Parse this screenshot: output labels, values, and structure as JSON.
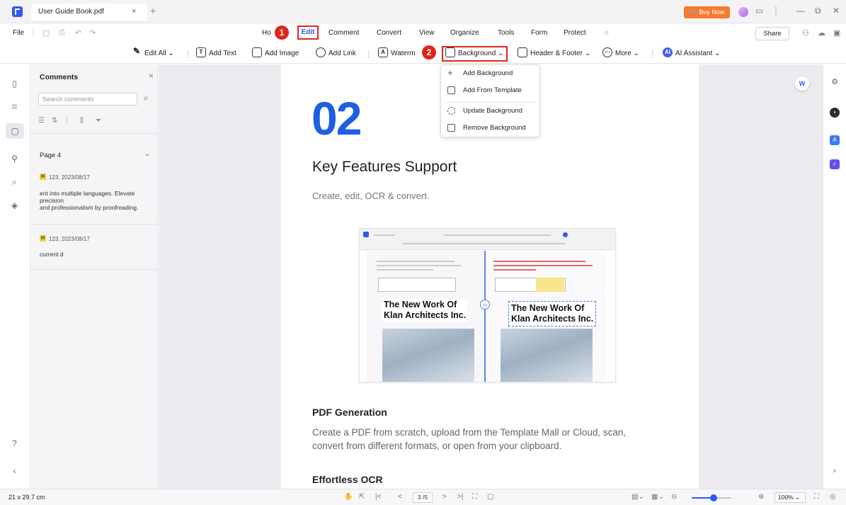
{
  "titlebar": {
    "tab_title": "User Guide Book.pdf",
    "tab_close": "×",
    "new_tab": "+",
    "buy_now": "🛒 Buy Now",
    "buy_now_color": "#f77a2f",
    "window_controls": [
      "—",
      "⧉",
      "✕"
    ],
    "icons": [
      "avatar-icon",
      "chat-icon",
      "more-icon"
    ]
  },
  "menubar": {
    "file": "File",
    "items": [
      "Home",
      "Edit",
      "Comment",
      "Convert",
      "View",
      "Organize",
      "Tools",
      "Form",
      "Protect"
    ],
    "home_visible": "Ho",
    "active": "Edit",
    "share": "Share",
    "accent_color": "#2a5bd7"
  },
  "badges": [
    "1",
    "2"
  ],
  "badge_color": "#e0261c",
  "toolbar": {
    "edit_all": "Edit All",
    "add_text": "Add Text",
    "add_image": "Add Image",
    "add_link": "Add Link",
    "watermark": "Waterm",
    "background": "Background",
    "header_footer": "Header & Footer",
    "more": "More",
    "ai_assistant": "AI Assistant",
    "text_icon": "T",
    "watermark_icon": "A",
    "ai_icon": "AI",
    "dropdown_caret": "⌄"
  },
  "background_menu": [
    "Add Background",
    "Add From Template",
    "Update Background",
    "Remove Background"
  ],
  "comments_panel": {
    "title": "Comments",
    "close": "×",
    "search_placeholder": "Search comments",
    "page_label": "Page 4",
    "comments": [
      {
        "tag": "H",
        "meta": "123, 2023/08/17",
        "text": "ent into multiple languages. Elevate precision\nand professionalism by proofreading."
      },
      {
        "tag": "H",
        "meta": "123, 2023/08/17",
        "text": "current d"
      }
    ]
  },
  "document": {
    "section_number": "02",
    "title": "Key Features Support",
    "subtitle": "Create, edit, OCR & convert.",
    "embedded_heading": "The New Work Of Klan Architects Inc.",
    "embedded_heading_lines": [
      "The New Work Of",
      "Klan Architects Inc."
    ],
    "pdf_generation_title": "PDF Generation",
    "pdf_generation_body": "Create a PDF from scratch, upload from the Template Mall or Cloud, scan, convert from different formats, or open from your clipboard.",
    "ocr_title": "Effortless OCR",
    "accent_color": "#1d5fe0"
  },
  "statusbar": {
    "page_size": "21 x 29.7 cm",
    "page_indicator": "3 /5",
    "zoom": "100%",
    "zoom_level": 0.55
  }
}
